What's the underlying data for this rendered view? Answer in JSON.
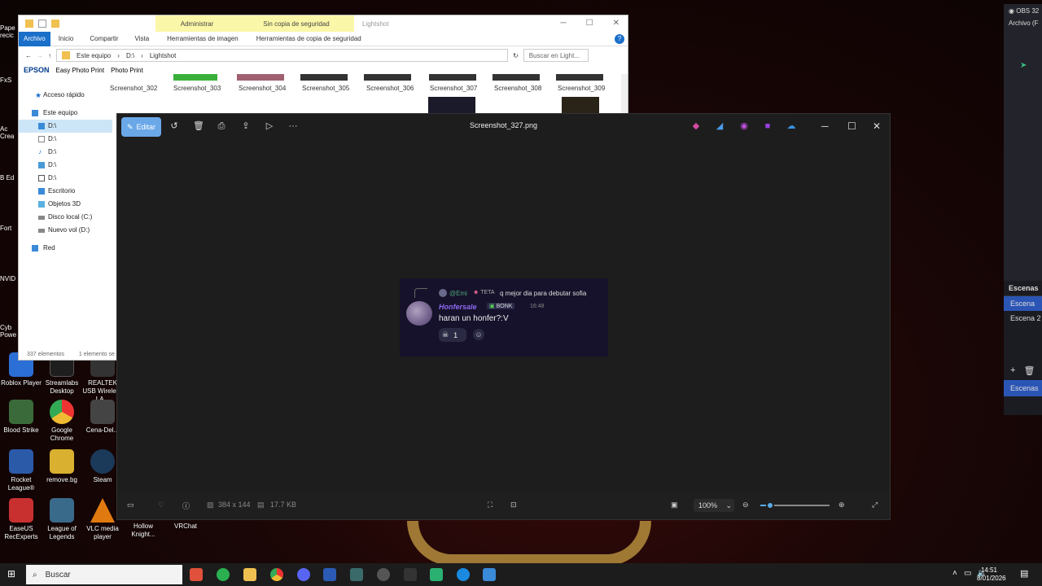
{
  "desktop": {
    "icons": [
      {
        "label": "Roblox Player",
        "color": "#2b6fd6"
      },
      {
        "label": "Streamlabs Desktop",
        "color": "#1e1e1e"
      },
      {
        "label": "REALTEK USB Wireless LA...",
        "color": "#333"
      },
      {
        "label": "Blood Strike",
        "color": "#3a6a3a"
      },
      {
        "label": "Google Chrome",
        "color": "#e0b020"
      },
      {
        "label": "Cena-Del...",
        "color": "#444"
      },
      {
        "label": "Rocket League®",
        "color": "#2b5aa8"
      },
      {
        "label": "remove.bg",
        "color": "#d9b030"
      },
      {
        "label": "Steam",
        "color": "#1b3a5a"
      },
      {
        "label": "EaseUS RecExperts",
        "color": "#c83030"
      },
      {
        "label": "League of Legends",
        "color": "#3a6a8a"
      },
      {
        "label": "VLC media player",
        "color": "#e07a10"
      },
      {
        "label": "Hollow Knight...",
        "color": "#222"
      },
      {
        "label": "VRChat",
        "color": "#222"
      }
    ],
    "edge_labels": [
      "Pape recic",
      "FxS",
      "Ac Crea",
      "B Ed",
      "Fort",
      "NVID",
      "Cyb Powe"
    ]
  },
  "explorer": {
    "ctx_admin": "Administrar",
    "ctx_backup": "Sin copia de seguridad",
    "title": "Lightshot",
    "tabs": [
      "Inicio",
      "Compartir",
      "Vista"
    ],
    "tab_archivo": "Archivo",
    "ctx_tab_image": "Herramientas de imagen",
    "ctx_tab_backup": "Herramientas de copia de seguridad",
    "path": [
      "Este equipo",
      "D:\\",
      "Lightshot"
    ],
    "search_placeholder": "Buscar en Light...",
    "epson_label": "EPSON",
    "easy_photo": "Easy Photo Print",
    "photo_print": "Photo Print",
    "sidebar": [
      "Acceso rápido",
      "Este equipo",
      "D:\\",
      "D:\\",
      "D:\\",
      "D:\\",
      "D:\\",
      "Escritorio",
      "Objetos 3D",
      "Disco local (C:)",
      "Nuevo vol (D:)",
      "Red"
    ],
    "thumbs": [
      "Screenshot_302",
      "Screenshot_303",
      "Screenshot_304",
      "Screenshot_305",
      "Screenshot_306",
      "Screenshot_307",
      "Screenshot_308",
      "Screenshot_309"
    ],
    "status_count": "337 elementos",
    "status_sel": "1 elemento se"
  },
  "viewer": {
    "edit_label": "Editar",
    "file_name": "Screenshot_327.png",
    "dimensions": "384 x 144",
    "file_size": "17.7 KB",
    "zoom": "100%",
    "zoom_level_pct": 14,
    "message": {
      "reply_user": "@Emi",
      "reply_tag": "TETA",
      "reply_text": "q mejor dia para debutar sofia",
      "author": "Honfersale",
      "author_tag": "BONK",
      "time": "16:48",
      "text": "haran un honfer?:V",
      "reaction_count": "1"
    }
  },
  "obs": {
    "title": "OBS 32",
    "archivo": "Archivo (F",
    "scenes_header": "Escenas",
    "scenes": [
      "Escena",
      "Escena 2"
    ],
    "footer": "Escenas"
  },
  "taskbar": {
    "search": "Buscar",
    "time": "14:51",
    "date": "8/01/2026"
  }
}
